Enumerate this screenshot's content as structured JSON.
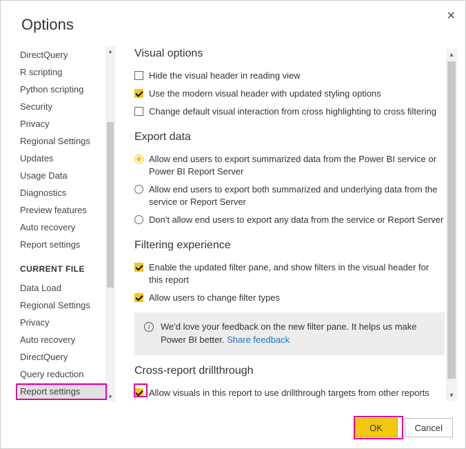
{
  "dialog": {
    "title": "Options",
    "ok": "OK",
    "cancel": "Cancel"
  },
  "sidebar": {
    "items": [
      "DirectQuery",
      "R scripting",
      "Python scripting",
      "Security",
      "Privacy",
      "Regional Settings",
      "Updates",
      "Usage Data",
      "Diagnostics",
      "Preview features",
      "Auto recovery",
      "Report settings"
    ],
    "sectionHead": "CURRENT FILE",
    "currentFileItems": [
      "Data Load",
      "Regional Settings",
      "Privacy",
      "Auto recovery",
      "DirectQuery",
      "Query reduction",
      "Report settings"
    ],
    "selectedIndex": 6
  },
  "main": {
    "visualOptions": {
      "title": "Visual options",
      "opt1": "Hide the visual header in reading view",
      "opt2": "Use the modern visual header with updated styling options",
      "opt3": "Change default visual interaction from cross highlighting to cross filtering"
    },
    "exportData": {
      "title": "Export data",
      "r1": "Allow end users to export summarized data from the Power BI service or Power BI Report Server",
      "r2": "Allow end users to export both summarized and underlying data from the service or Report Server",
      "r3": "Don't allow end users to export any data from the service or Report Server"
    },
    "filtering": {
      "title": "Filtering experience",
      "c1": "Enable the updated filter pane, and show filters in the visual header for this report",
      "c2": "Allow users to change filter types",
      "feedback": "We'd love your feedback on the new filter pane. It helps us make Power BI better. ",
      "feedbackLink": "Share feedback"
    },
    "cross": {
      "title": "Cross-report drillthrough",
      "c1": "Allow visuals in this report to use drillthrough targets from other reports"
    }
  }
}
